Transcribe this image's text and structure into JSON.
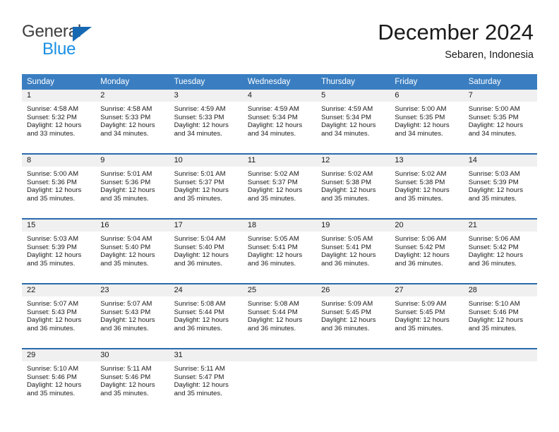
{
  "logo": {
    "word_one": "General",
    "word_two": "Blue",
    "triangle_color": "#1668b3",
    "word_one_color": "#3d3d3d",
    "word_two_color": "#1a8fe3"
  },
  "header": {
    "title": "December 2024",
    "subtitle": "Sebaren, Indonesia"
  },
  "theme": {
    "header_row_bg": "#3a7ec1",
    "header_row_text": "#ffffff",
    "week_divider": "#2a6aad",
    "day_number_strip_bg": "#f0f0f0",
    "page_bg": "#ffffff",
    "text": "#1a1a1a"
  },
  "calendar": {
    "day_names": [
      "Sunday",
      "Monday",
      "Tuesday",
      "Wednesday",
      "Thursday",
      "Friday",
      "Saturday"
    ],
    "weeks": [
      [
        {
          "day": "1",
          "sunrise": "Sunrise: 4:58 AM",
          "sunset": "Sunset: 5:32 PM",
          "daylight": "Daylight: 12 hours and 33 minutes."
        },
        {
          "day": "2",
          "sunrise": "Sunrise: 4:58 AM",
          "sunset": "Sunset: 5:33 PM",
          "daylight": "Daylight: 12 hours and 34 minutes."
        },
        {
          "day": "3",
          "sunrise": "Sunrise: 4:59 AM",
          "sunset": "Sunset: 5:33 PM",
          "daylight": "Daylight: 12 hours and 34 minutes."
        },
        {
          "day": "4",
          "sunrise": "Sunrise: 4:59 AM",
          "sunset": "Sunset: 5:34 PM",
          "daylight": "Daylight: 12 hours and 34 minutes."
        },
        {
          "day": "5",
          "sunrise": "Sunrise: 4:59 AM",
          "sunset": "Sunset: 5:34 PM",
          "daylight": "Daylight: 12 hours and 34 minutes."
        },
        {
          "day": "6",
          "sunrise": "Sunrise: 5:00 AM",
          "sunset": "Sunset: 5:35 PM",
          "daylight": "Daylight: 12 hours and 34 minutes."
        },
        {
          "day": "7",
          "sunrise": "Sunrise: 5:00 AM",
          "sunset": "Sunset: 5:35 PM",
          "daylight": "Daylight: 12 hours and 34 minutes."
        }
      ],
      [
        {
          "day": "8",
          "sunrise": "Sunrise: 5:00 AM",
          "sunset": "Sunset: 5:36 PM",
          "daylight": "Daylight: 12 hours and 35 minutes."
        },
        {
          "day": "9",
          "sunrise": "Sunrise: 5:01 AM",
          "sunset": "Sunset: 5:36 PM",
          "daylight": "Daylight: 12 hours and 35 minutes."
        },
        {
          "day": "10",
          "sunrise": "Sunrise: 5:01 AM",
          "sunset": "Sunset: 5:37 PM",
          "daylight": "Daylight: 12 hours and 35 minutes."
        },
        {
          "day": "11",
          "sunrise": "Sunrise: 5:02 AM",
          "sunset": "Sunset: 5:37 PM",
          "daylight": "Daylight: 12 hours and 35 minutes."
        },
        {
          "day": "12",
          "sunrise": "Sunrise: 5:02 AM",
          "sunset": "Sunset: 5:38 PM",
          "daylight": "Daylight: 12 hours and 35 minutes."
        },
        {
          "day": "13",
          "sunrise": "Sunrise: 5:02 AM",
          "sunset": "Sunset: 5:38 PM",
          "daylight": "Daylight: 12 hours and 35 minutes."
        },
        {
          "day": "14",
          "sunrise": "Sunrise: 5:03 AM",
          "sunset": "Sunset: 5:39 PM",
          "daylight": "Daylight: 12 hours and 35 minutes."
        }
      ],
      [
        {
          "day": "15",
          "sunrise": "Sunrise: 5:03 AM",
          "sunset": "Sunset: 5:39 PM",
          "daylight": "Daylight: 12 hours and 35 minutes."
        },
        {
          "day": "16",
          "sunrise": "Sunrise: 5:04 AM",
          "sunset": "Sunset: 5:40 PM",
          "daylight": "Daylight: 12 hours and 35 minutes."
        },
        {
          "day": "17",
          "sunrise": "Sunrise: 5:04 AM",
          "sunset": "Sunset: 5:40 PM",
          "daylight": "Daylight: 12 hours and 36 minutes."
        },
        {
          "day": "18",
          "sunrise": "Sunrise: 5:05 AM",
          "sunset": "Sunset: 5:41 PM",
          "daylight": "Daylight: 12 hours and 36 minutes."
        },
        {
          "day": "19",
          "sunrise": "Sunrise: 5:05 AM",
          "sunset": "Sunset: 5:41 PM",
          "daylight": "Daylight: 12 hours and 36 minutes."
        },
        {
          "day": "20",
          "sunrise": "Sunrise: 5:06 AM",
          "sunset": "Sunset: 5:42 PM",
          "daylight": "Daylight: 12 hours and 36 minutes."
        },
        {
          "day": "21",
          "sunrise": "Sunrise: 5:06 AM",
          "sunset": "Sunset: 5:42 PM",
          "daylight": "Daylight: 12 hours and 36 minutes."
        }
      ],
      [
        {
          "day": "22",
          "sunrise": "Sunrise: 5:07 AM",
          "sunset": "Sunset: 5:43 PM",
          "daylight": "Daylight: 12 hours and 36 minutes."
        },
        {
          "day": "23",
          "sunrise": "Sunrise: 5:07 AM",
          "sunset": "Sunset: 5:43 PM",
          "daylight": "Daylight: 12 hours and 36 minutes."
        },
        {
          "day": "24",
          "sunrise": "Sunrise: 5:08 AM",
          "sunset": "Sunset: 5:44 PM",
          "daylight": "Daylight: 12 hours and 36 minutes."
        },
        {
          "day": "25",
          "sunrise": "Sunrise: 5:08 AM",
          "sunset": "Sunset: 5:44 PM",
          "daylight": "Daylight: 12 hours and 36 minutes."
        },
        {
          "day": "26",
          "sunrise": "Sunrise: 5:09 AM",
          "sunset": "Sunset: 5:45 PM",
          "daylight": "Daylight: 12 hours and 36 minutes."
        },
        {
          "day": "27",
          "sunrise": "Sunrise: 5:09 AM",
          "sunset": "Sunset: 5:45 PM",
          "daylight": "Daylight: 12 hours and 35 minutes."
        },
        {
          "day": "28",
          "sunrise": "Sunrise: 5:10 AM",
          "sunset": "Sunset: 5:46 PM",
          "daylight": "Daylight: 12 hours and 35 minutes."
        }
      ],
      [
        {
          "day": "29",
          "sunrise": "Sunrise: 5:10 AM",
          "sunset": "Sunset: 5:46 PM",
          "daylight": "Daylight: 12 hours and 35 minutes."
        },
        {
          "day": "30",
          "sunrise": "Sunrise: 5:11 AM",
          "sunset": "Sunset: 5:46 PM",
          "daylight": "Daylight: 12 hours and 35 minutes."
        },
        {
          "day": "31",
          "sunrise": "Sunrise: 5:11 AM",
          "sunset": "Sunset: 5:47 PM",
          "daylight": "Daylight: 12 hours and 35 minutes."
        },
        {
          "day": "",
          "sunrise": "",
          "sunset": "",
          "daylight": ""
        },
        {
          "day": "",
          "sunrise": "",
          "sunset": "",
          "daylight": ""
        },
        {
          "day": "",
          "sunrise": "",
          "sunset": "",
          "daylight": ""
        },
        {
          "day": "",
          "sunrise": "",
          "sunset": "",
          "daylight": ""
        }
      ]
    ]
  }
}
